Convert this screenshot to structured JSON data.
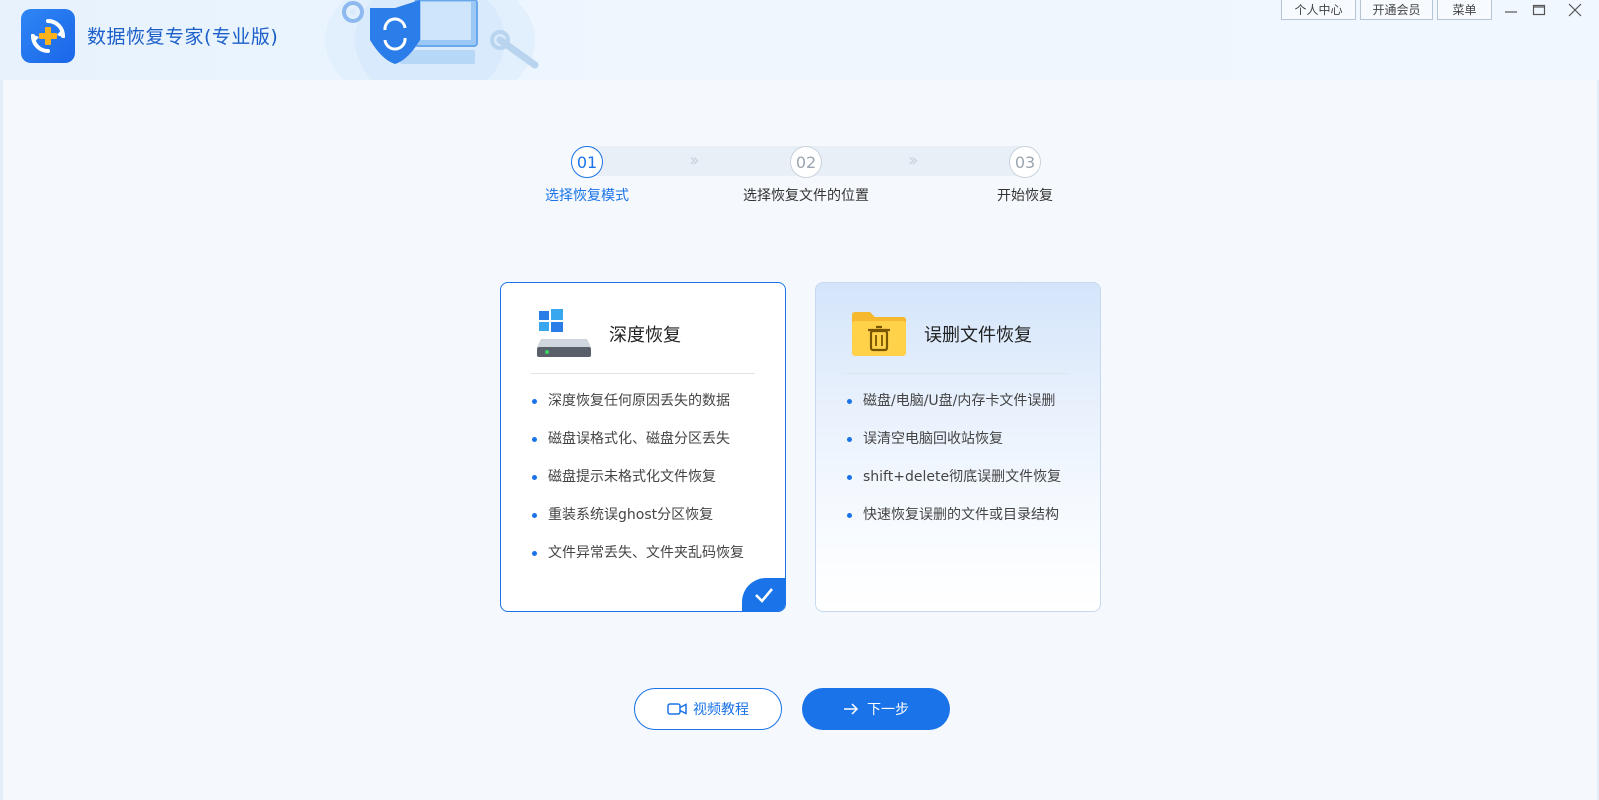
{
  "app": {
    "title": "数据恢复专家(专业版)"
  },
  "topbar": {
    "personal_center": "个人中心",
    "membership": "开通会员",
    "menu": "菜单"
  },
  "steps": [
    {
      "number": "01",
      "label": "选择恢复模式",
      "active": true
    },
    {
      "number": "02",
      "label": "选择恢复文件的位置",
      "active": false
    },
    {
      "number": "03",
      "label": "开始恢复",
      "active": false
    }
  ],
  "cards": [
    {
      "title": "深度恢复",
      "icon": "hard-drive-windows-icon",
      "selected": true,
      "items": [
        "深度恢复任何原因丢失的数据",
        "磁盘误格式化、磁盘分区丢失",
        "磁盘提示未格式化文件恢复",
        "重装系统误ghost分区恢复",
        "文件异常丢失、文件夹乱码恢复"
      ]
    },
    {
      "title": "误删文件恢复",
      "icon": "folder-trash-icon",
      "selected": false,
      "items": [
        "磁盘/电脑/U盘/内存卡文件误删",
        "误清空电脑回收站恢复",
        "shift+delete彻底误删文件恢复",
        "快速恢复误删的文件或目录结构"
      ]
    }
  ],
  "buttons": {
    "video": "视频教程",
    "next": "下一步"
  },
  "colors": {
    "accent": "#1a73e8",
    "title": "#1b5fc9"
  }
}
